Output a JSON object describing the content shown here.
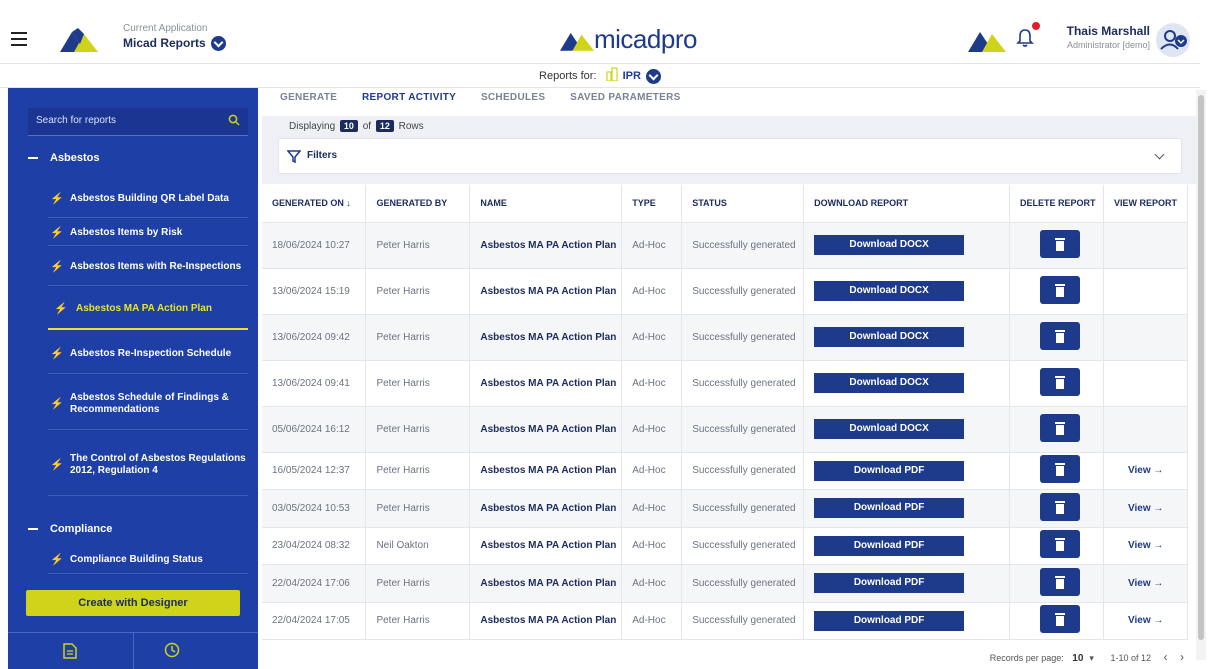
{
  "header": {
    "app_label": "Current Application",
    "app_name": "Micad Reports",
    "brand_main": "micad",
    "brand_suffix": "pro",
    "user_name": "Thais Marshall",
    "user_role": "Administrator [demo]"
  },
  "reports_for": {
    "label": "Reports for:",
    "value": "IPR"
  },
  "sidebar": {
    "search_placeholder": "Search for reports",
    "sections": [
      {
        "title": "Asbestos"
      },
      {
        "title": "Compliance"
      }
    ],
    "items": [
      {
        "label": "Asbestos Building QR Label Data"
      },
      {
        "label": "Asbestos Items by Risk"
      },
      {
        "label": "Asbestos Items with Re-Inspections"
      },
      {
        "label": "Asbestos MA PA Action Plan"
      },
      {
        "label": "Asbestos Re-Inspection Schedule"
      },
      {
        "label": "Asbestos Schedule of Findings & Recommendations"
      },
      {
        "label": "The Control of Asbestos Regulations 2012, Regulation 4"
      },
      {
        "label": "Compliance Building Status"
      }
    ],
    "designer_button": "Create with Designer"
  },
  "tabs": [
    "GENERATE",
    "REPORT ACTIVITY",
    "SCHEDULES",
    "SAVED PARAMETERS"
  ],
  "display": {
    "prefix": "Displaying",
    "shown": "10",
    "of": "of",
    "total": "12",
    "suffix": "Rows"
  },
  "filters_label": "Filters",
  "table": {
    "headers": [
      "GENERATED ON ↓",
      "GENERATED BY",
      "NAME",
      "TYPE",
      "STATUS",
      "DOWNLOAD REPORT",
      "DELETE REPORT",
      "VIEW REPORT"
    ],
    "rows": [
      {
        "date": "18/06/2024 10:27",
        "by": "Peter Harris",
        "name": "Asbestos MA PA Action Plan",
        "type": "Ad-Hoc",
        "status": "Successfully generated",
        "download": "Download DOCX",
        "view": ""
      },
      {
        "date": "13/06/2024 15:19",
        "by": "Peter Harris",
        "name": "Asbestos MA PA Action Plan",
        "type": "Ad-Hoc",
        "status": "Successfully generated",
        "download": "Download DOCX",
        "view": ""
      },
      {
        "date": "13/06/2024 09:42",
        "by": "Peter Harris",
        "name": "Asbestos MA PA Action Plan",
        "type": "Ad-Hoc",
        "status": "Successfully generated",
        "download": "Download DOCX",
        "view": ""
      },
      {
        "date": "13/06/2024 09:41",
        "by": "Peter Harris",
        "name": "Asbestos MA PA Action Plan",
        "type": "Ad-Hoc",
        "status": "Successfully generated",
        "download": "Download DOCX",
        "view": ""
      },
      {
        "date": "05/06/2024 16:12",
        "by": "Peter Harris",
        "name": "Asbestos MA PA Action Plan",
        "type": "Ad-Hoc",
        "status": "Successfully generated",
        "download": "Download DOCX",
        "view": ""
      },
      {
        "date": "16/05/2024 12:37",
        "by": "Peter Harris",
        "name": "Asbestos MA PA Action Plan",
        "type": "Ad-Hoc",
        "status": "Successfully generated",
        "download": "Download PDF",
        "view": "View →"
      },
      {
        "date": "03/05/2024 10:53",
        "by": "Peter Harris",
        "name": "Asbestos MA PA Action Plan",
        "type": "Ad-Hoc",
        "status": "Successfully generated",
        "download": "Download PDF",
        "view": "View →"
      },
      {
        "date": "23/04/2024 08:32",
        "by": "Neil Oakton",
        "name": "Asbestos MA PA Action Plan",
        "type": "Ad-Hoc",
        "status": "Successfully generated",
        "download": "Download PDF",
        "view": "View →"
      },
      {
        "date": "22/04/2024 17:06",
        "by": "Peter Harris",
        "name": "Asbestos MA PA Action Plan",
        "type": "Ad-Hoc",
        "status": "Successfully generated",
        "download": "Download PDF",
        "view": "View →"
      },
      {
        "date": "22/04/2024 17:05",
        "by": "Peter Harris",
        "name": "Asbestos MA PA Action Plan",
        "type": "Ad-Hoc",
        "status": "Successfully generated",
        "download": "Download PDF",
        "view": "View →"
      }
    ]
  },
  "pagination": {
    "label": "Records per page:",
    "per_page": "10",
    "range": "1-10 of 12"
  },
  "colors": {
    "primary": "#1e3a8a",
    "sidebar": "#1e3fa6",
    "accent_yellow": "#cfd41a",
    "notification": "#e11d2a"
  }
}
